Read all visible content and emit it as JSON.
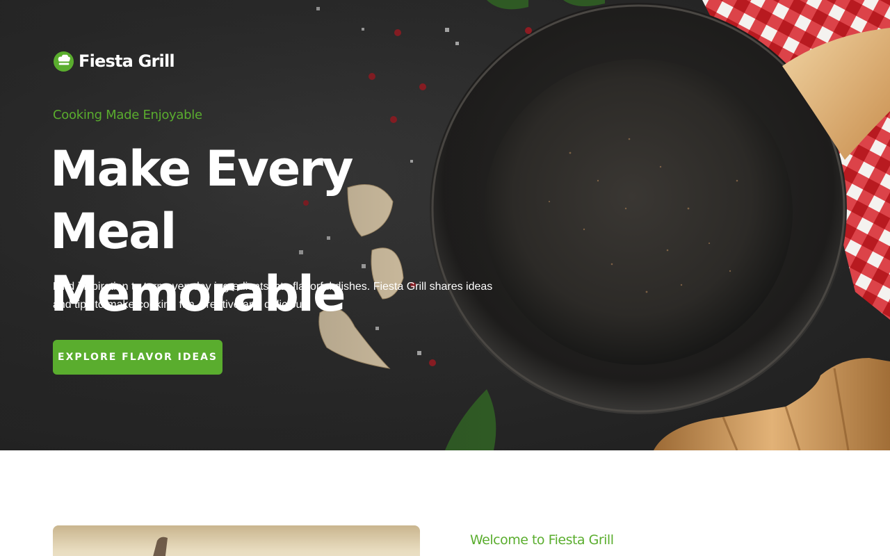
{
  "brand": {
    "name": "Fiesta Grill",
    "accent_color": "#5aad2e",
    "logo_icon": "chef-hat-icon"
  },
  "hero": {
    "eyebrow": "Cooking Made Enjoyable",
    "headline_line1": "Make Every Meal",
    "headline_line2": "Memorable",
    "lead": "Find inspiration to turn everyday ingredients into flavorful dishes. Fiesta Grill shares ideas and tips to make cooking fun, creative and delicious.",
    "cta_label": "EXPLORE FLAVOR IDEAS"
  },
  "welcome": {
    "title": "Welcome to Fiesta Grill"
  }
}
